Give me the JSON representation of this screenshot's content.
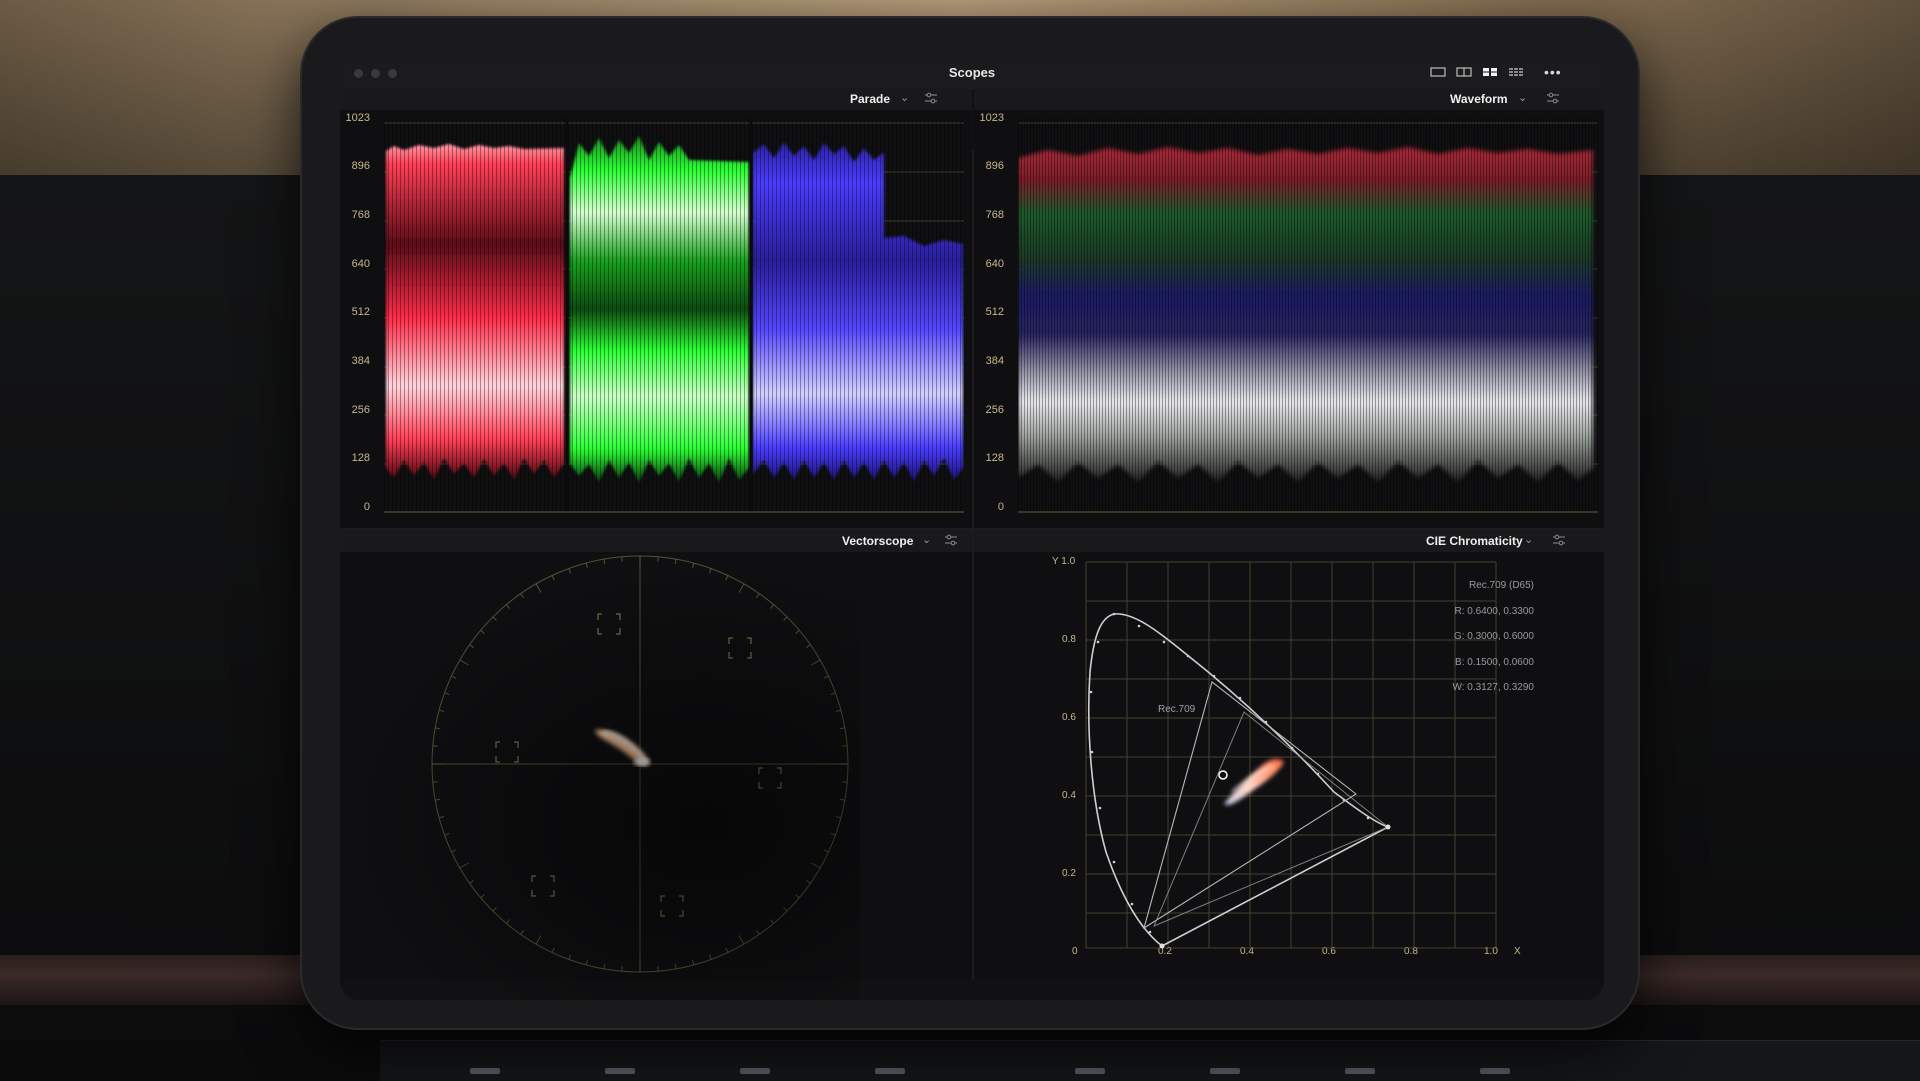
{
  "window": {
    "title": "Scopes",
    "layout_buttons": [
      "single-view-icon",
      "two-up-view-icon",
      "quad-view-icon",
      "grid-view-icon"
    ],
    "more_icon": "•••"
  },
  "panels": {
    "parade": {
      "label": "Parade",
      "chevron": "⌄",
      "settings_icon": "⚙",
      "y_ticks": [
        "1023",
        "896",
        "768",
        "640",
        "512",
        "384",
        "256",
        "128",
        "0"
      ],
      "channels": [
        "red",
        "green",
        "blue"
      ]
    },
    "waveform": {
      "label": "Waveform",
      "chevron": "⌄",
      "settings_icon": "⚙",
      "y_ticks": [
        "1023",
        "896",
        "768",
        "640",
        "512",
        "384",
        "256",
        "128",
        "0"
      ]
    },
    "vectorscope": {
      "label": "Vectorscope",
      "chevron": "⌄",
      "settings_icon": "⚙",
      "targets": [
        "R",
        "Mg",
        "B",
        "Cy",
        "G",
        "Yl"
      ]
    },
    "cie": {
      "label": "CIE Chromaticity",
      "chevron": "⌄",
      "settings_icon": "⚙",
      "y_axis_label": "Y 1.0",
      "x_axis_label": "X",
      "y_ticks": [
        "0.8",
        "0.6",
        "0.4",
        "0.2",
        "0"
      ],
      "x_ticks": [
        "0.2",
        "0.4",
        "0.6",
        "0.8",
        "1.0"
      ],
      "gamut_label": "Rec.709",
      "info": [
        "Rec.709 (D65)",
        "R: 0.6400, 0.3300",
        "G: 0.3000, 0.6000",
        "B: 0.1500, 0.0600",
        "W: 0.3127, 0.3290"
      ]
    }
  },
  "colors": {
    "accent_tick": "#c9b78a",
    "red_channel": "#ff3e55",
    "green_channel": "#2cff35",
    "blue_channel": "#4a3cff",
    "panel_bg": "#0f0f11"
  }
}
